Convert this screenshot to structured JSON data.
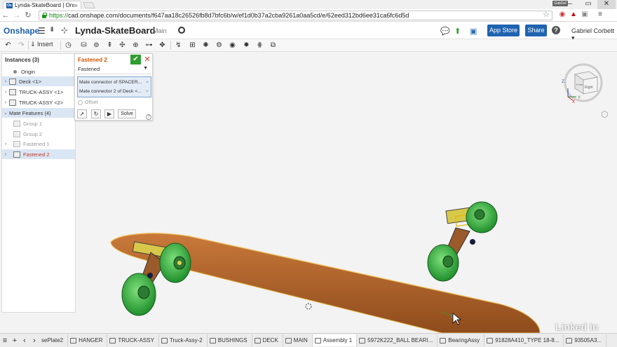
{
  "browser": {
    "tab_title": "Lynda-SkateBoard | Onsh",
    "tab_favicon": "Os",
    "url_https": "https://",
    "url_rest": "cad.onshape.com/documents/f647aa18c26526fb8d7bfc6b/w/ef1d0b37a2cba9261a0aa5cd/e/62eed312bd6ee31ca6fc6d5d",
    "window_label": "GabDef"
  },
  "header": {
    "logo": "Onshape",
    "doc_name": "Lynda-SkateBoard",
    "branch": "Main",
    "app_store": "App Store",
    "share": "Share",
    "help": "?",
    "user": "Gabriel Corbett ▾"
  },
  "toolbar": {
    "insert_label": "Insert"
  },
  "instances": {
    "title": "Instances (3)",
    "rows": [
      {
        "label": "Origin"
      },
      {
        "label": "Deck <1>"
      },
      {
        "label": "TRUCK-ASSY <1>"
      },
      {
        "label": "TRUCK-ASSY <2>"
      },
      {
        "label": "Mate Features (4)"
      },
      {
        "label": "Group 1"
      },
      {
        "label": "Group 2"
      },
      {
        "label": "Fastened 1"
      },
      {
        "label": "Fastened 2"
      }
    ]
  },
  "dialog": {
    "title": "Fastened 2",
    "type": "Fastened",
    "connectors": [
      {
        "label": "Mate connector of SPACER..."
      },
      {
        "label": "Mate connector 2 of Deck <..."
      }
    ],
    "offset": "Offset",
    "solve": "Solve"
  },
  "viewcube": {
    "front": "Front",
    "right": "Right",
    "x": "X",
    "y": "Y",
    "z": "Z"
  },
  "bottom_tabs": [
    {
      "label": "sePlate2"
    },
    {
      "label": "HANGER"
    },
    {
      "label": "TRUCK-ASSY"
    },
    {
      "label": "Truck-Assy-2"
    },
    {
      "label": "BUSHINGS"
    },
    {
      "label": "DECK"
    },
    {
      "label": "MAIN"
    },
    {
      "label": "Assembly 1",
      "active": true
    },
    {
      "label": "5972K222_BALL BEARI..."
    },
    {
      "label": "BearingAssy"
    },
    {
      "label": "91828A410_TYPE 18-8..."
    },
    {
      "label": "93505A3..."
    }
  ],
  "watermark": "Linked in",
  "colors": {
    "brand": "#1f5fa8",
    "deck": "#b86a2b",
    "wheel": "#3fb84a",
    "dialog_title": "#d35400",
    "ok_green": "#2e9e2e"
  }
}
